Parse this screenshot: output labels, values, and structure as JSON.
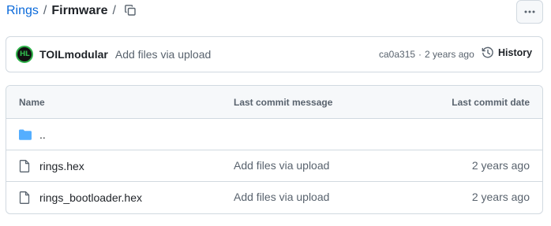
{
  "breadcrumb": {
    "repo": "Rings",
    "separator": "/",
    "folder": "Firmware",
    "trailing_separator": "/"
  },
  "icons": {
    "copy": "copy-icon",
    "more": "kebab-horizontal-icon",
    "history": "history-icon",
    "folder": "folder-icon",
    "file": "file-icon"
  },
  "latest_commit": {
    "avatar_text": "HL",
    "author": "TOILmodular",
    "message": "Add files via upload",
    "sha": "ca0a315",
    "dot": "·",
    "age": "2 years ago",
    "history_label": "History"
  },
  "table": {
    "headers": {
      "name": "Name",
      "message": "Last commit message",
      "date": "Last commit date"
    },
    "rows": [
      {
        "type": "folder",
        "name": "..",
        "message": "",
        "date": ""
      },
      {
        "type": "file",
        "name": "rings.hex",
        "message": "Add files via upload",
        "date": "2 years ago"
      },
      {
        "type": "file",
        "name": "rings_bootloader.hex",
        "message": "Add files via upload",
        "date": "2 years ago"
      }
    ]
  },
  "colors": {
    "link": "#0969da",
    "folder": "#54aeff",
    "muted": "#59636e",
    "border": "#d1d9e0",
    "avatar_accent": "#2fb34a"
  }
}
